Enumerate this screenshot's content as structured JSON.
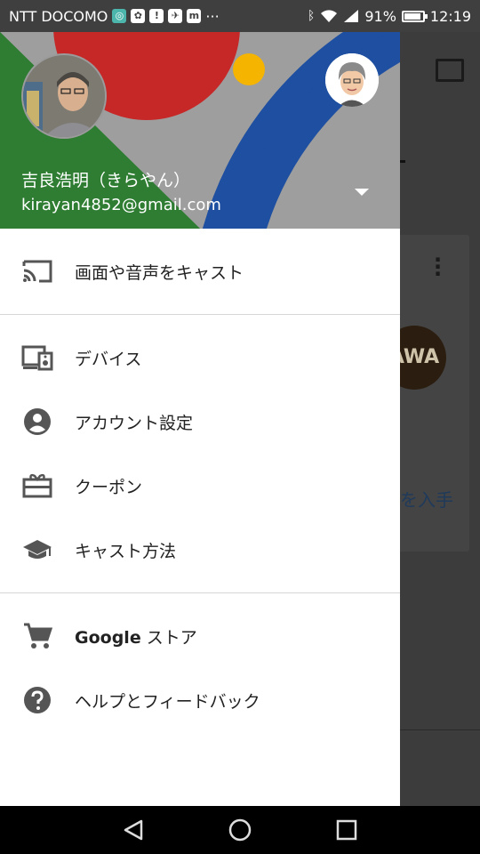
{
  "status_bar": {
    "carrier": "NTT DOCOMO",
    "battery": "91%",
    "battery_level": 0.91,
    "time": "12:19",
    "more": "···"
  },
  "drawer": {
    "user": {
      "name": "吉良浩明（きらやん）",
      "email": "kirayan4852@gmail.com"
    },
    "sections": [
      [
        {
          "id": "cast",
          "icon": "cast-icon",
          "label": "画面や音声をキャスト"
        }
      ],
      [
        {
          "id": "devices",
          "icon": "devices-icon",
          "label": "デバイス"
        },
        {
          "id": "account-settings",
          "icon": "account-circle-icon",
          "label": "アカウント設定"
        },
        {
          "id": "coupons",
          "icon": "gift-card-icon",
          "label": "クーポン"
        },
        {
          "id": "how-to-cast",
          "icon": "school-icon",
          "label": "キャスト方法"
        }
      ],
      [
        {
          "id": "google-store",
          "icon": "shopping-cart-icon",
          "label_bold": "Google",
          "label": " ストア"
        },
        {
          "id": "help-feedback",
          "icon": "help-icon",
          "label": "ヘルプとフィードバック"
        }
      ]
    ]
  },
  "background_app": {
    "partial_text": "を入手",
    "logo_text": "AWA"
  },
  "colors": {
    "header_green": "#2e7d32",
    "header_red": "#c62828",
    "header_blue": "#1e4fa0",
    "header_yellow": "#f4b400",
    "header_gray": "#9e9e9e",
    "icon_color": "#555555"
  }
}
